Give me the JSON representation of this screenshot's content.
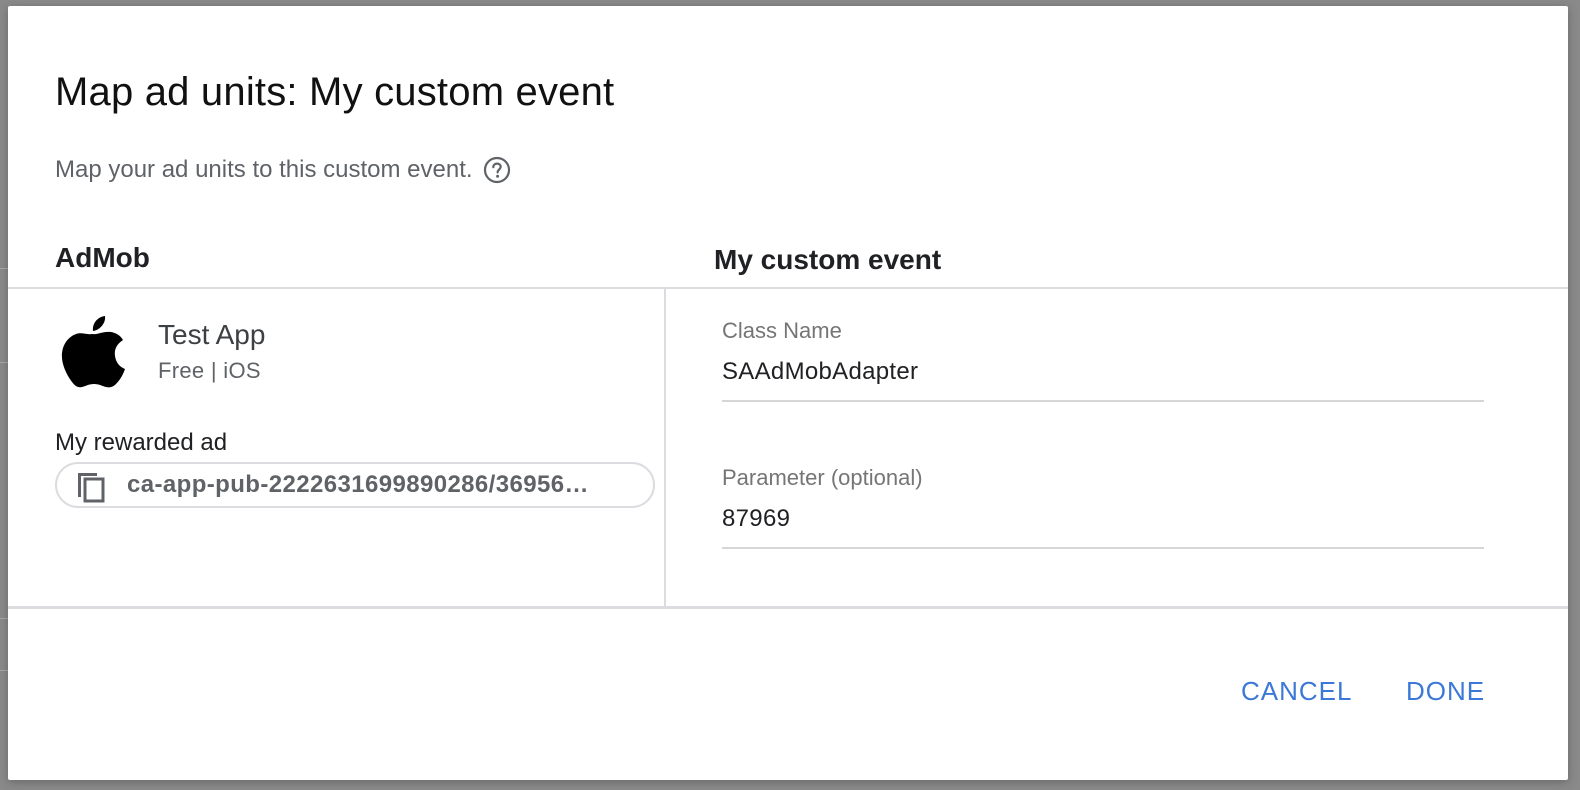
{
  "dialog": {
    "title": "Map ad units: My custom event",
    "subtitle": "Map your ad units to this custom event.",
    "help_icon": "help-circle-icon"
  },
  "columns": {
    "left_header": "AdMob",
    "right_header": "My custom event"
  },
  "app": {
    "icon": "apple-icon",
    "name": "Test App",
    "meta": "Free | iOS"
  },
  "ad_unit": {
    "name": "My rewarded ad",
    "copy_icon": "copy-icon",
    "id": "ca-app-pub-2222631699890286/36956…"
  },
  "custom_event": {
    "class_name_label": "Class Name",
    "class_name_value": "SAAdMobAdapter",
    "parameter_label": "Parameter (optional)",
    "parameter_value": "87969"
  },
  "actions": {
    "cancel_label": "CANCEL",
    "done_label": "DONE"
  },
  "colors": {
    "accent": "#3b78d8",
    "divider": "#dadce0",
    "backdrop": "#8a8a8a"
  }
}
